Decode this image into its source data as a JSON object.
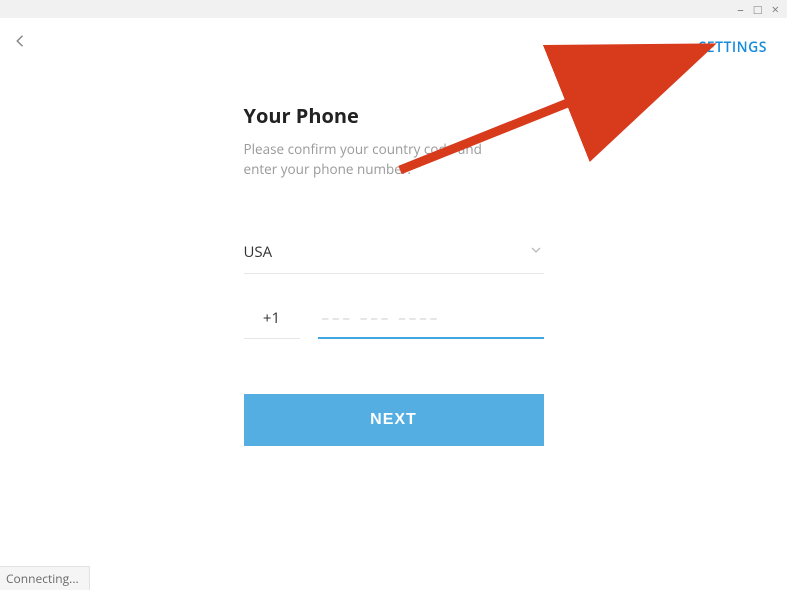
{
  "window": {
    "minimize": "–",
    "maximize": "□",
    "close": "×"
  },
  "header": {
    "settings_label": "SETTINGS"
  },
  "main": {
    "title": "Your Phone",
    "subtitle_line1": "Please confirm your country code and",
    "subtitle_line2": "enter your phone number.",
    "country": "USA",
    "dial_code": "+1",
    "phone_value": "",
    "phone_placeholder": "––– ––– ––––",
    "next_label": "NEXT"
  },
  "status": {
    "text": "Connecting..."
  },
  "colors": {
    "accent": "#178cde",
    "button": "#54aee1",
    "input_focus": "#40a7e3"
  }
}
